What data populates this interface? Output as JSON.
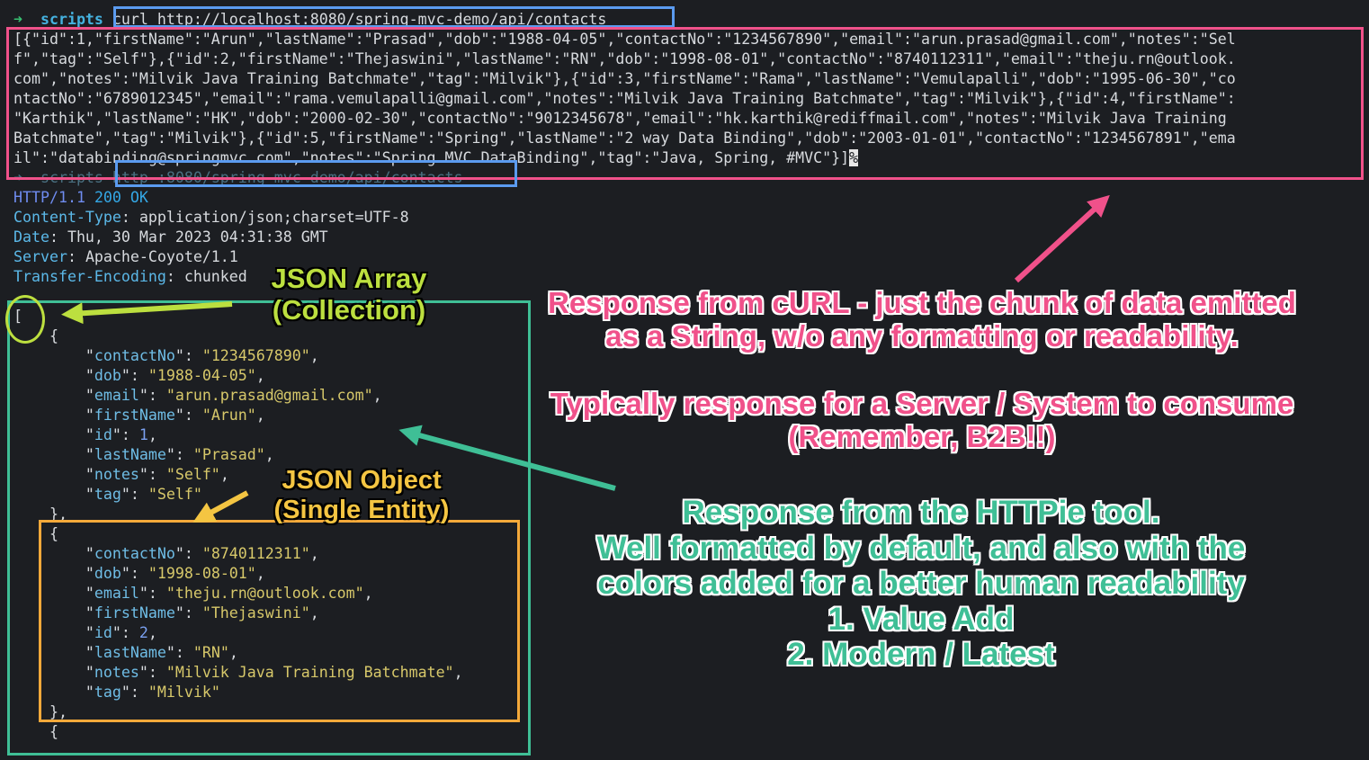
{
  "terminal": {
    "prompt_arrow": "➜",
    "prompt_dir": "scripts",
    "curl_command": "curl http://localhost:8080/spring-mvc-demo/api/contacts",
    "curl_output": [
      "[{\"id\":1,\"firstName\":\"Arun\",\"lastName\":\"Prasad\",\"dob\":\"1988-04-05\",\"contactNo\":\"1234567890\",\"email\":\"arun.prasad@gmail.com\",\"notes\":\"Sel",
      "f\",\"tag\":\"Self\"},{\"id\":2,\"firstName\":\"Thejaswini\",\"lastName\":\"RN\",\"dob\":\"1998-08-01\",\"contactNo\":\"8740112311\",\"email\":\"theju.rn@outlook.",
      "com\",\"notes\":\"Milvik Java Training Batchmate\",\"tag\":\"Milvik\"},{\"id\":3,\"firstName\":\"Rama\",\"lastName\":\"Vemulapalli\",\"dob\":\"1995-06-30\",\"co",
      "ntactNo\":\"6789012345\",\"email\":\"rama.vemulapalli@gmail.com\",\"notes\":\"Milvik Java Training Batchmate\",\"tag\":\"Milvik\"},{\"id\":4,\"firstName\":",
      "\"Karthik\",\"lastName\":\"HK\",\"dob\":\"2000-02-30\",\"contactNo\":\"9012345678\",\"email\":\"hk.karthik@rediffmail.com\",\"notes\":\"Milvik Java Training",
      "Batchmate\",\"tag\":\"Milvik\"},{\"id\":5,\"firstName\":\"Spring\",\"lastName\":\"2 way Data Binding\",\"dob\":\"2003-01-01\",\"contactNo\":\"1234567891\",\"ema",
      "il\":\"databinding@springmvc.com\",\"notes\":\"Spring MVC DataBinding\",\"tag\":\"Java, Spring, #MVC\"}]"
    ],
    "curl_eol_mark": "%",
    "http_command": "http :8080/spring-mvc-demo/api/contacts",
    "status_line": {
      "proto": "HTTP",
      "version": "/1.1",
      "code": "200",
      "reason": "OK"
    },
    "headers": [
      {
        "key": "Content-Type",
        "value": "application/json;charset=UTF-8"
      },
      {
        "key": "Date",
        "value": "Thu, 30 Mar 2023 04:31:38 GMT"
      },
      {
        "key": "Server",
        "value": "Apache-Coyote/1.1"
      },
      {
        "key": "Transfer-Encoding",
        "value": "chunked"
      }
    ],
    "json_open": "[",
    "object_open": "{",
    "object_close": "},",
    "contacts": [
      {
        "fields": [
          {
            "key": "contactNo",
            "value": "\"1234567890\"",
            "type": "str"
          },
          {
            "key": "dob",
            "value": "\"1988-04-05\"",
            "type": "str"
          },
          {
            "key": "email",
            "value": "\"arun.prasad@gmail.com\"",
            "type": "str"
          },
          {
            "key": "firstName",
            "value": "\"Arun\"",
            "type": "str"
          },
          {
            "key": "id",
            "value": "1",
            "type": "num"
          },
          {
            "key": "lastName",
            "value": "\"Prasad\"",
            "type": "str"
          },
          {
            "key": "notes",
            "value": "\"Self\"",
            "type": "str"
          },
          {
            "key": "tag",
            "value": "\"Self\"",
            "type": "str"
          }
        ]
      },
      {
        "fields": [
          {
            "key": "contactNo",
            "value": "\"8740112311\"",
            "type": "str"
          },
          {
            "key": "dob",
            "value": "\"1998-08-01\"",
            "type": "str"
          },
          {
            "key": "email",
            "value": "\"theju.rn@outlook.com\"",
            "type": "str"
          },
          {
            "key": "firstName",
            "value": "\"Thejaswini\"",
            "type": "str"
          },
          {
            "key": "id",
            "value": "2",
            "type": "num"
          },
          {
            "key": "lastName",
            "value": "\"RN\"",
            "type": "str"
          },
          {
            "key": "notes",
            "value": "\"Milvik Java Training Batchmate\"",
            "type": "str"
          },
          {
            "key": "tag",
            "value": "\"Milvik\"",
            "type": "str"
          }
        ]
      }
    ]
  },
  "annotations": {
    "json_array": "JSON Array\n(Collection)",
    "json_object": "JSON Object\n(Single Entity)",
    "curl_note": "Response from cURL - just the chunk of data emitted\nas a String, w/o any formatting or readability.\n\nTypically response for a Server / System to consume\n(Remember, B2B!!)",
    "httpie_note": "Response from the HTTPie tool.\nWell formatted by default, and also with the\ncolors added for a better human readability\n1. Value Add\n2. Modern / Latest"
  },
  "colors": {
    "pink": "#f0518a",
    "blue": "#5b9bf0",
    "teal": "#3fbf96",
    "lime": "#bcdf3f",
    "amber": "#f4c542",
    "background": "#1c1e22"
  }
}
